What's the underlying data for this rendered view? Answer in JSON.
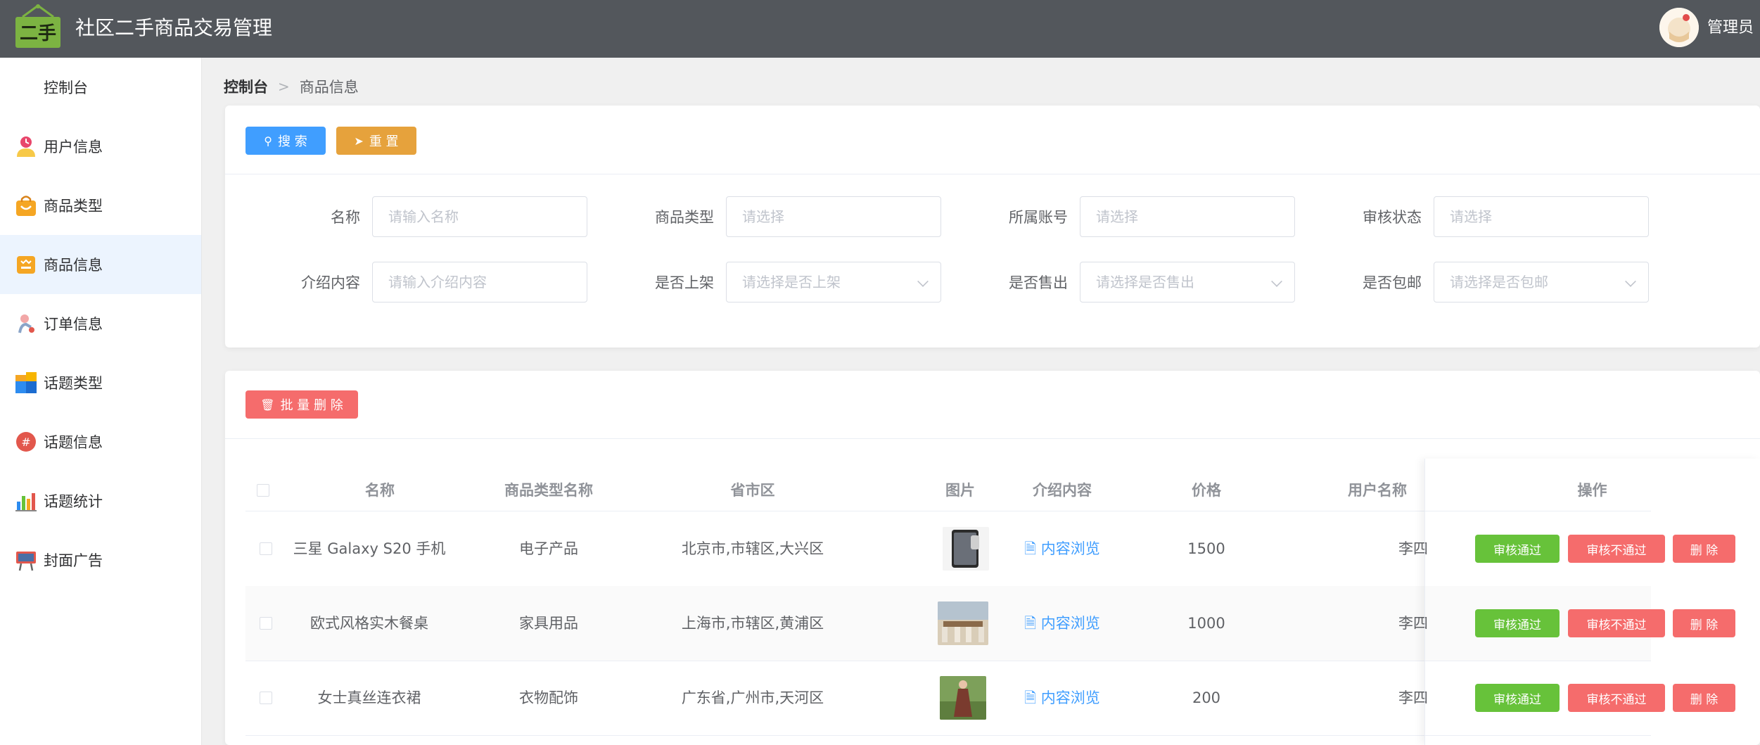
{
  "header": {
    "logo_text": "二手",
    "app_title": "社区二手商品交易管理",
    "user_name": "管理员",
    "colors": {
      "bar": "#53575c",
      "logo": "#7cb342"
    }
  },
  "sidebar": {
    "items": [
      {
        "label": "控制台",
        "icon": "none"
      },
      {
        "label": "用户信息",
        "icon": "user-icon"
      },
      {
        "label": "商品类型",
        "icon": "shopping-bag-icon"
      },
      {
        "label": "商品信息",
        "icon": "product-icon",
        "active": true
      },
      {
        "label": "订单信息",
        "icon": "order-icon"
      },
      {
        "label": "话题类型",
        "icon": "blocks-icon"
      },
      {
        "label": "话题信息",
        "icon": "hashtag-icon"
      },
      {
        "label": "话题统计",
        "icon": "bar-chart-icon"
      },
      {
        "label": "封面广告",
        "icon": "billboard-icon"
      }
    ]
  },
  "breadcrumb": {
    "root": "控制台",
    "separator": ">",
    "current": "商品信息"
  },
  "toolbar": {
    "search_label": "搜 索",
    "reset_label": "重 置"
  },
  "filters": {
    "name": {
      "label": "名称",
      "placeholder": "请输入名称"
    },
    "category": {
      "label": "商品类型",
      "placeholder": "请选择"
    },
    "account": {
      "label": "所属账号",
      "placeholder": "请选择"
    },
    "audit": {
      "label": "审核状态",
      "placeholder": "请选择"
    },
    "intro": {
      "label": "介绍内容",
      "placeholder": "请输入介绍内容"
    },
    "listed": {
      "label": "是否上架",
      "placeholder": "请选择是否上架"
    },
    "sold": {
      "label": "是否售出",
      "placeholder": "请选择是否售出"
    },
    "shipping": {
      "label": "是否包邮",
      "placeholder": "请选择是否包邮"
    }
  },
  "list": {
    "batch_delete_label": "批 量 删 除",
    "columns": [
      "名称",
      "商品类型名称",
      "省市区",
      "图片",
      "介绍内容",
      "价格",
      "用户名称",
      "操作"
    ],
    "preview_label": "内容浏览",
    "actions": {
      "approve": "审核通过",
      "reject": "审核不通过",
      "delete": "删 除"
    },
    "rows": [
      {
        "name": "三星 Galaxy S20 手机",
        "category": "电子产品",
        "region": "北京市,市辖区,大兴区",
        "price": "1500",
        "user": "李四"
      },
      {
        "name": "欧式风格实木餐桌",
        "category": "家具用品",
        "region": "上海市,市辖区,黄浦区",
        "price": "1000",
        "user": "李四"
      },
      {
        "name": "女士真丝连衣裙",
        "category": "衣物配饰",
        "region": "广东省,广州市,天河区",
        "price": "200",
        "user": "李四"
      }
    ]
  },
  "colors": {
    "primary": "#409eff",
    "warning": "#e6a23c",
    "danger": "#f56c6c",
    "success": "#67c23a",
    "active_menu_bg": "#ecf4fe"
  }
}
